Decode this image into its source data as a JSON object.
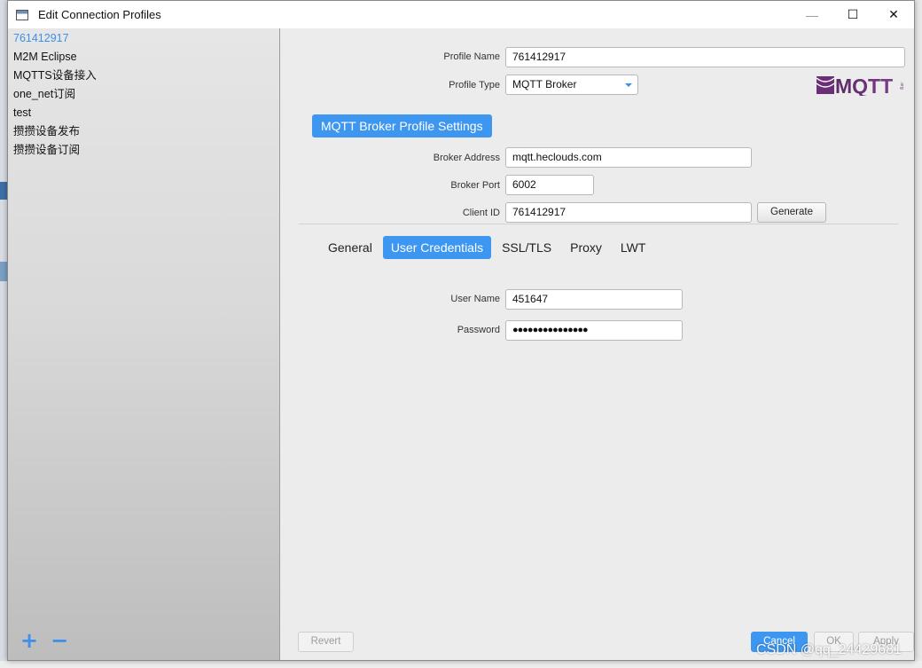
{
  "window": {
    "title": "Edit Connection Profiles",
    "controls": {
      "minimize": "—",
      "maximize": "☐",
      "close": "✕"
    }
  },
  "sidebar": {
    "profiles": [
      {
        "label": "761412917",
        "active": true
      },
      {
        "label": "M2M Eclipse",
        "active": false
      },
      {
        "label": "MQTTS设备接入",
        "active": false
      },
      {
        "label": "one_net订阅",
        "active": false
      },
      {
        "label": "test",
        "active": false
      },
      {
        "label": "攒攒设备发布",
        "active": false
      },
      {
        "label": "攒攒设备订阅",
        "active": false
      }
    ],
    "add_label": "+",
    "remove_label": "−"
  },
  "form": {
    "profile_name_label": "Profile Name",
    "profile_name_value": "761412917",
    "profile_type_label": "Profile Type",
    "profile_type_value": "MQTT Broker",
    "logo_text": "MQTT",
    "logo_subtext": ".org",
    "section_title": "MQTT Broker Profile Settings",
    "broker_address_label": "Broker Address",
    "broker_address_value": "mqtt.heclouds.com",
    "broker_port_label": "Broker Port",
    "broker_port_value": "6002",
    "client_id_label": "Client ID",
    "client_id_value": "761412917",
    "generate_label": "Generate"
  },
  "tabs": [
    {
      "label": "General",
      "active": false
    },
    {
      "label": "User Credentials",
      "active": true
    },
    {
      "label": "SSL/TLS",
      "active": false
    },
    {
      "label": "Proxy",
      "active": false
    },
    {
      "label": "LWT",
      "active": false
    }
  ],
  "credentials": {
    "username_label": "User Name",
    "username_value": "451647",
    "password_label": "Password",
    "password_value": "●●●●●●●●●●●●●●●"
  },
  "footer": {
    "revert_label": "Revert",
    "cancel_label": "Cancel",
    "ok_label": "OK",
    "apply_label": "Apply"
  },
  "watermark": "CSDN @qq_24429681",
  "colors": {
    "accent": "#3d97f0",
    "active_text": "#3d8fe8"
  }
}
